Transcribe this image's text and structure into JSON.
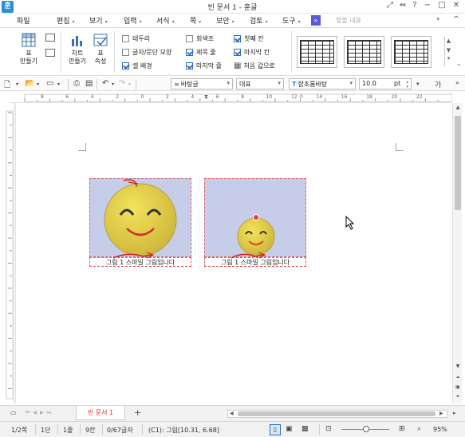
{
  "titlebar": {
    "title": "빈 문서 1 - 훈글",
    "logo": "훈"
  },
  "menu": {
    "items": [
      "파일",
      "편집",
      "보기",
      "입력",
      "서식",
      "쪽",
      "보안",
      "검토",
      "도구"
    ],
    "search_placeholder": "찾을 내용"
  },
  "ribbon": {
    "btn_table": "표\n만들기",
    "btn_chart": "차트\n만들기",
    "btn_props": "표\n속성",
    "checks": [
      {
        "label": "테두리",
        "checked": false
      },
      {
        "label": "글자/문단 모양",
        "checked": false
      },
      {
        "label": "셀 배경",
        "checked": true
      },
      {
        "label": "회색조",
        "checked": false
      },
      {
        "label": "제목 줄",
        "checked": true
      },
      {
        "label": "마지막 줄",
        "checked": true
      },
      {
        "label": "첫째 칸",
        "checked": true
      },
      {
        "label": "마지막 칸",
        "checked": true
      }
    ],
    "reset_label": "처음 값으로"
  },
  "format": {
    "style": "바탕글",
    "lang": "대표",
    "font": "함초롬바탕",
    "size": "10.0",
    "unit": "pt",
    "bold_icon": "가"
  },
  "ruler_numbers": [
    "8",
    "6",
    "4",
    "2",
    "0",
    "2",
    "4",
    "6",
    "8",
    "10",
    "12",
    "14",
    "16",
    "18",
    "20",
    "22"
  ],
  "figures": {
    "caption_1": "그림 1 스마일 그림입니다",
    "caption_2": "그림 1 스마일 그림입니다"
  },
  "tabbar": {
    "doc_tab": "빈 문서 1",
    "add": "+"
  },
  "status": {
    "page": "1/2쪽",
    "col": "1단",
    "line": "1줄",
    "cell": "9칸",
    "chars": "0/67글자",
    "pos": "(C1): 그림[10.31, 6.68]",
    "zoom": "95%"
  }
}
